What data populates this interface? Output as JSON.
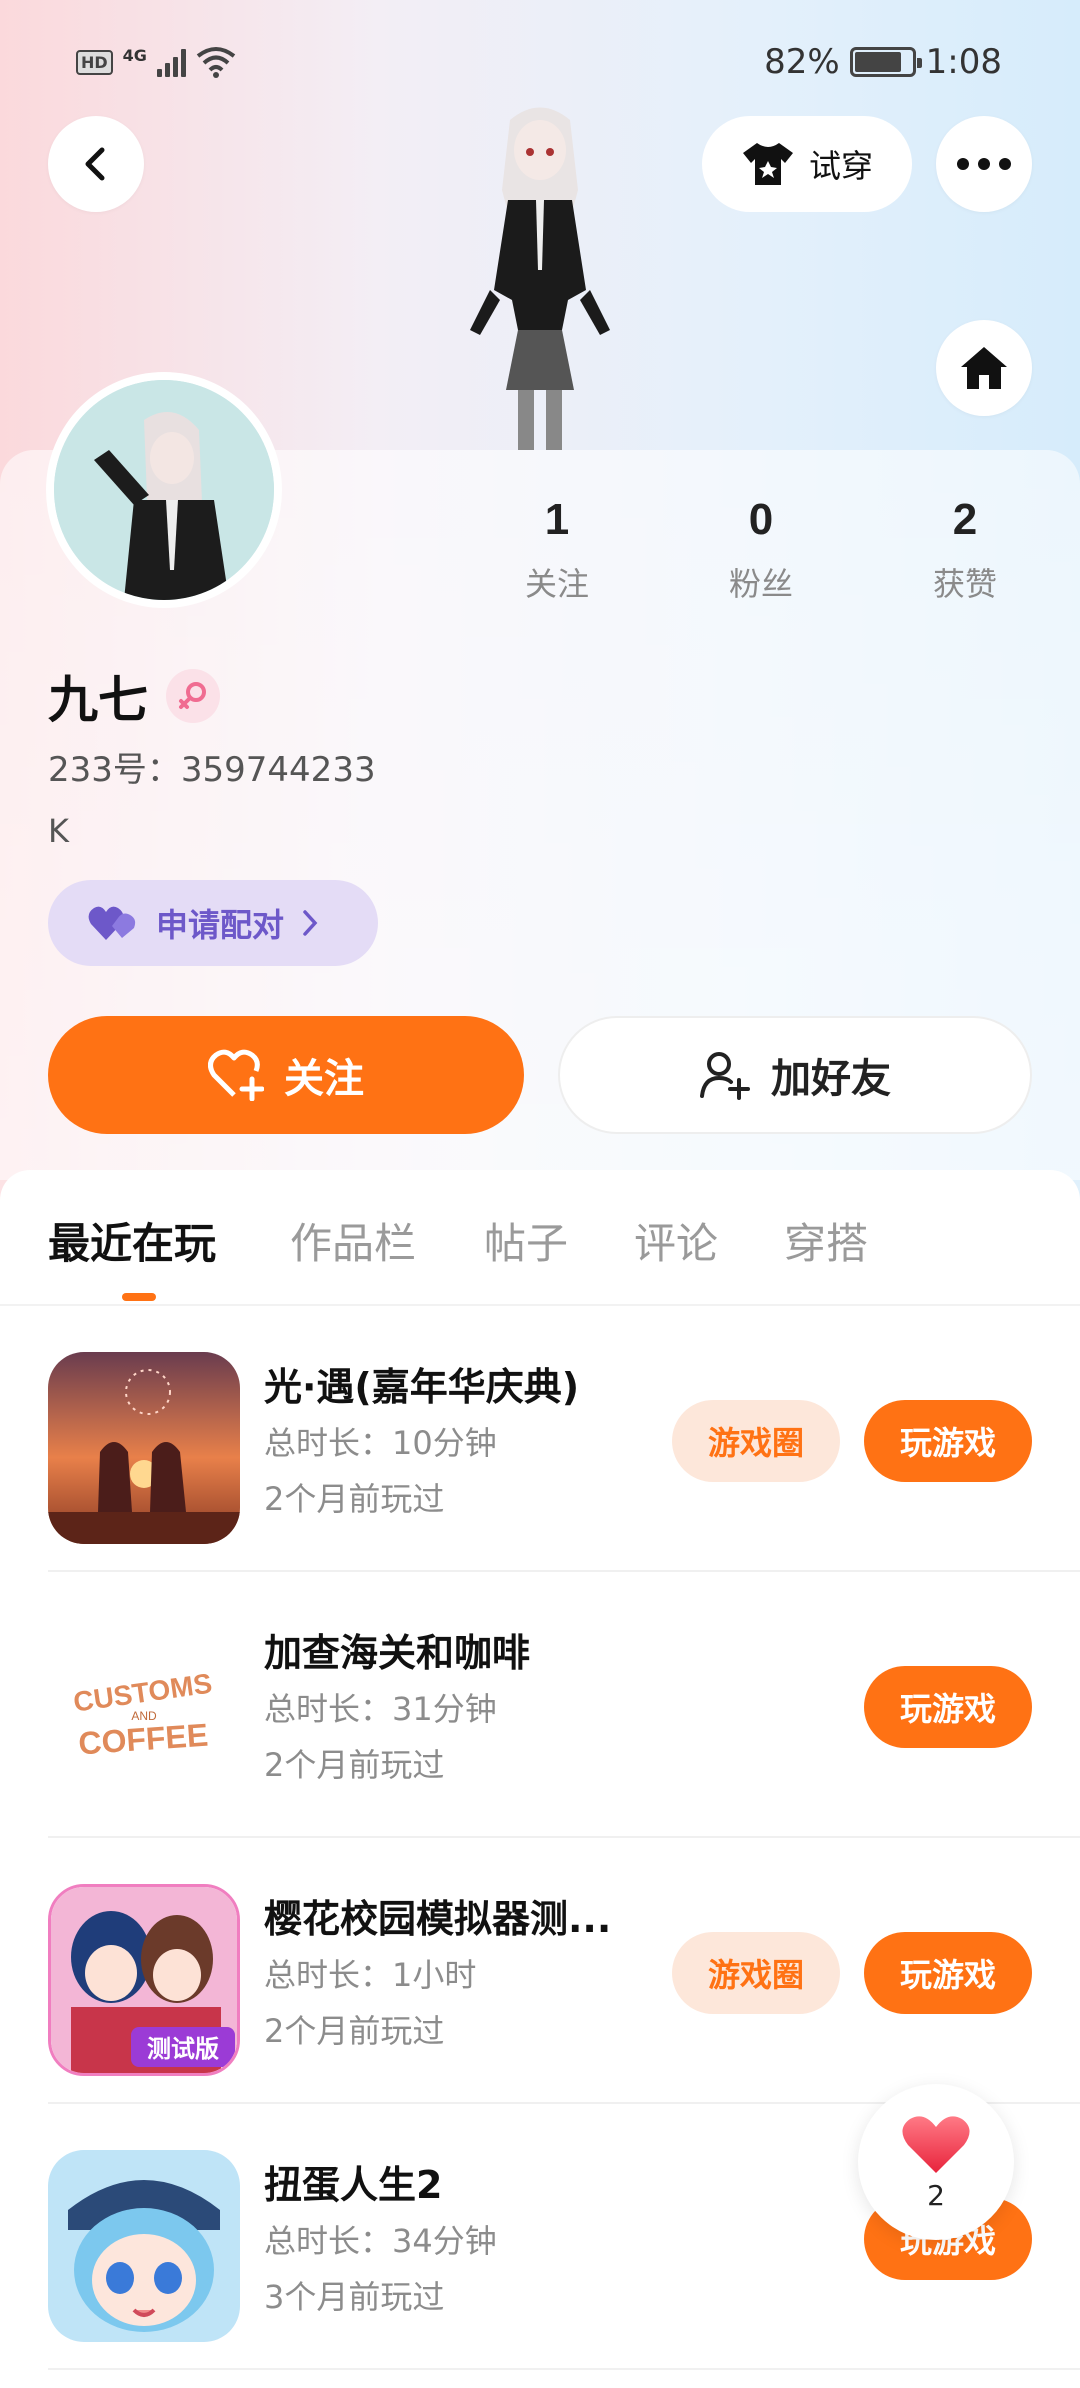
{
  "status_bar": {
    "hd": "HD",
    "network": "4G",
    "battery": "82%",
    "time": "1:08"
  },
  "header": {
    "try_on_label": "试穿"
  },
  "profile": {
    "stats": [
      {
        "value": "1",
        "label": "关注"
      },
      {
        "value": "0",
        "label": "粉丝"
      },
      {
        "value": "2",
        "label": "获赞"
      }
    ],
    "name": "九七",
    "uid": "233号：359744233",
    "bio": "K",
    "pair_label": "申请配对",
    "follow_label": "关注",
    "add_friend_label": "加好友"
  },
  "tabs": [
    {
      "label": "最近在玩",
      "active": true
    },
    {
      "label": "作品栏",
      "active": false
    },
    {
      "label": "帖子",
      "active": false
    },
    {
      "label": "评论",
      "active": false
    },
    {
      "label": "穿搭",
      "active": false
    }
  ],
  "games": [
    {
      "title": "光·遇(嘉年华庆典)",
      "duration": "总时长：10分钟",
      "last_played": "2个月前玩过",
      "circle_label": "游戏圈",
      "play_label": "玩游戏"
    },
    {
      "title": "加查海关和咖啡",
      "duration": "总时长：31分钟",
      "last_played": "2个月前玩过",
      "play_label": "玩游戏",
      "icon_text_line1": "CUSTOMS",
      "icon_text_line2": "AND",
      "icon_text_line3": "COFFEE"
    },
    {
      "title": "樱花校园模拟器测...",
      "duration": "总时长：1小时",
      "last_played": "2个月前玩过",
      "circle_label": "游戏圈",
      "play_label": "玩游戏",
      "icon_badge": "测试版"
    },
    {
      "title": "扭蛋人生2",
      "duration": "总时长：34分钟",
      "last_played": "3个月前玩过",
      "play_label": "玩游戏"
    }
  ],
  "like_float": {
    "count": "2"
  },
  "colors": {
    "accent": "#ff7214",
    "pair_bg": "#e4dcf6",
    "pair_text": "#6d58c9",
    "circle_bg": "#fde7da"
  }
}
